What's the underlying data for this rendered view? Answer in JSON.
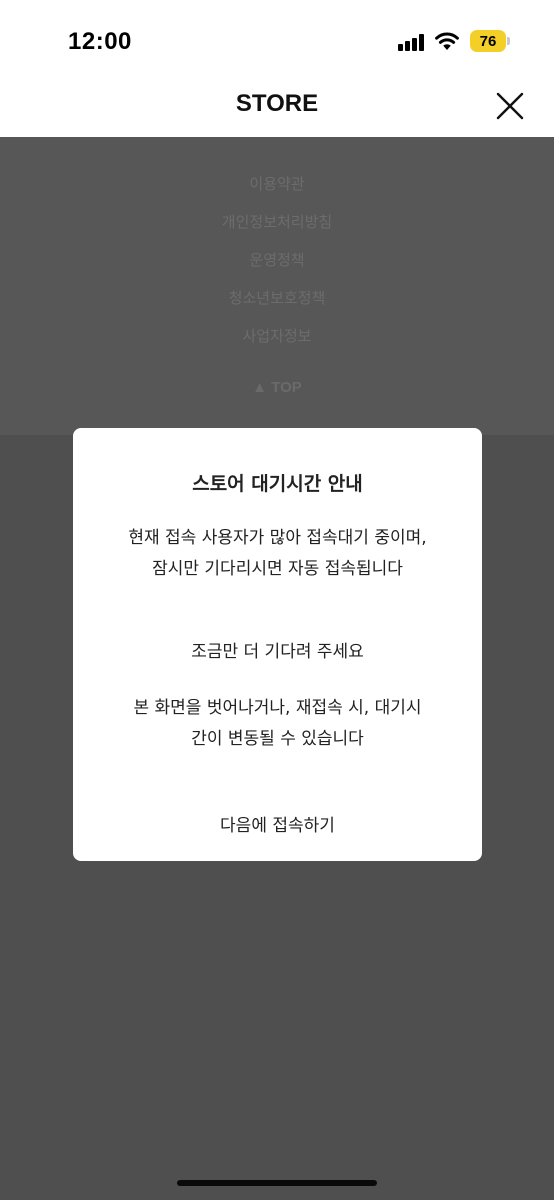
{
  "status_bar": {
    "time": "12:00",
    "battery": "76",
    "battery_color": "#f4cf28",
    "icons": [
      "signal-icon",
      "wifi-icon",
      "battery-icon"
    ]
  },
  "header": {
    "title": "STORE",
    "close_icon": "close-icon"
  },
  "footer": {
    "links": [
      "이용약관",
      "개인정보처리방침",
      "운영정책",
      "청소년보호정책",
      "사업자정보"
    ],
    "top_label": "▲ TOP"
  },
  "modal": {
    "title": "스토어 대기시간 안내",
    "message_line1": "현재 접속 사용자가 많아 접속대기 중이며,",
    "message_line2": "잠시만 기다리시면 자동 접속됩니다",
    "wait_message": "조금만 더 기다려 주세요",
    "warning_line1": "본 화면을 벗어나거나, 재접속 시, 대기시",
    "warning_line2": "간이 변동될 수 있습니다",
    "action_label": "다음에 접속하기"
  },
  "colors": {
    "overlay": "#4f4f4f",
    "accent_battery": "#f4cf28"
  }
}
